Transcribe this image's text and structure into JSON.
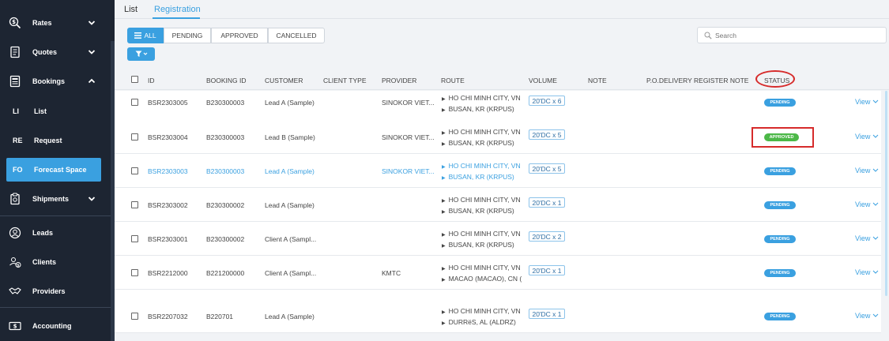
{
  "sidebar": {
    "items": [
      {
        "label": "Rates",
        "icon": "dollar-search-icon"
      },
      {
        "label": "Quotes",
        "icon": "document-icon"
      },
      {
        "label": "Bookings",
        "icon": "booking-icon"
      },
      {
        "label": "Shipments",
        "icon": "clipboard-icon"
      },
      {
        "label": "Leads",
        "icon": "user-circle-icon"
      },
      {
        "label": "Clients",
        "icon": "client-coin-icon"
      },
      {
        "label": "Providers",
        "icon": "handshake-icon"
      },
      {
        "label": "Accounting",
        "icon": "cash-icon"
      }
    ],
    "sub_items": [
      {
        "abbr": "LI",
        "label": "List"
      },
      {
        "abbr": "RE",
        "label": "Request"
      },
      {
        "abbr": "FO",
        "label": "Forecast Space"
      }
    ]
  },
  "tabs": {
    "list": "List",
    "registration": "Registration"
  },
  "filters": {
    "all": "ALL",
    "pending": "PENDING",
    "approved": "APPROVED",
    "cancelled": "CANCELLED"
  },
  "search": {
    "placeholder": "Search"
  },
  "table": {
    "headers": {
      "id": "ID",
      "booking_id": "BOOKING ID",
      "customer": "CUSTOMER",
      "client_type": "CLIENT TYPE",
      "provider": "PROVIDER",
      "route": "ROUTE",
      "volume": "VOLUME",
      "note": "NOTE",
      "po": "P.O.DELIVERY REGISTER NOTE",
      "status": "STATUS"
    },
    "rows": [
      {
        "id": "BSR2303005",
        "booking_id": "B230300003",
        "customer": "Lead A (Sample)",
        "client_type": "",
        "provider": "SINOKOR VIET...",
        "origin": "HO CHI MINH CITY, VN",
        "destination": "BUSAN, KR (KRPUS)",
        "volume": "20'DC x 6",
        "status": "PENDING",
        "view": "View"
      },
      {
        "id": "BSR2303004",
        "booking_id": "B230300003",
        "customer": "Lead B (Sample)",
        "client_type": "",
        "provider": "SINOKOR VIET...",
        "origin": "HO CHI MINH CITY, VN",
        "destination": "BUSAN, KR (KRPUS)",
        "volume": "20'DC x 5",
        "status": "APPROVED",
        "view": "View"
      },
      {
        "id": "BSR2303003",
        "booking_id": "B230300003",
        "customer": "Lead A (Sample)",
        "client_type": "",
        "provider": "SINOKOR VIET...",
        "origin": "HO CHI MINH CITY, VN",
        "destination": "BUSAN, KR (KRPUS)",
        "volume": "20'DC x 5",
        "status": "PENDING",
        "view": "View"
      },
      {
        "id": "BSR2303002",
        "booking_id": "B230300002",
        "customer": "Lead A (Sample)",
        "client_type": "",
        "provider": "",
        "origin": "HO CHI MINH CITY, VN",
        "destination": "BUSAN, KR (KRPUS)",
        "volume": "20'DC x 1",
        "status": "PENDING",
        "view": "View"
      },
      {
        "id": "BSR2303001",
        "booking_id": "B230300002",
        "customer": "Client A (Sampl...",
        "client_type": "",
        "provider": "",
        "origin": "HO CHI MINH CITY, VN",
        "destination": "BUSAN, KR (KRPUS)",
        "volume": "20'DC x 2",
        "status": "PENDING",
        "view": "View"
      },
      {
        "id": "BSR2212000",
        "booking_id": "B221200000",
        "customer": "Client A (Sampl...",
        "client_type": "",
        "provider": "KMTC",
        "origin": "HO CHI MINH CITY, VN",
        "destination": "MACAO (MACAO), CN (",
        "volume": "20'DC x 1",
        "status": "PENDING",
        "view": "View"
      },
      {
        "id": "BSR2207032",
        "booking_id": "B220701",
        "customer": "Lead A (Sample)",
        "client_type": "",
        "provider": "",
        "origin": "HO CHI MINH CITY, VN",
        "destination": "DURRëS, AL (ALDRZ)",
        "volume": "20'DC x 1",
        "status": "PENDING",
        "view": "View"
      }
    ]
  },
  "colors": {
    "accent": "#3aa0e0",
    "sidebar_bg": "#1d2532",
    "approved": "#4cb848",
    "highlight": "#d62b2b"
  }
}
